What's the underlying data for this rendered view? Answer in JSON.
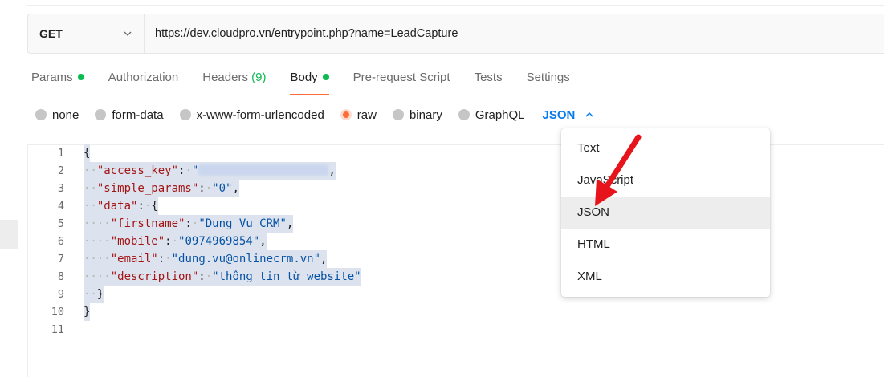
{
  "request": {
    "method": "GET",
    "url": "https://dev.cloudpro.vn/entrypoint.php?name=LeadCapture"
  },
  "tabs": [
    {
      "label": "Params",
      "dot": true
    },
    {
      "label": "Authorization"
    },
    {
      "label": "Headers",
      "count": "(9)"
    },
    {
      "label": "Body",
      "dot": true,
      "active": true
    },
    {
      "label": "Pre-request Script"
    },
    {
      "label": "Tests"
    },
    {
      "label": "Settings"
    }
  ],
  "body_types": {
    "options": [
      "none",
      "form-data",
      "x-www-form-urlencoded",
      "raw",
      "binary",
      "GraphQL"
    ],
    "selected": "raw",
    "language": "JSON"
  },
  "editor": {
    "line_numbers": [
      "1",
      "2",
      "3",
      "4",
      "5",
      "6",
      "7",
      "8",
      "9",
      "10",
      "11"
    ],
    "open_brace": "{",
    "close_brace": "}",
    "access_key": "\"access_key\"",
    "simple_params_key": "\"simple_params\"",
    "simple_params_value": "\"0\"",
    "data_key": "\"data\"",
    "firstname_key": "\"firstname\"",
    "firstname_value": "\"Dung Vu CRM\"",
    "mobile_key": "\"mobile\"",
    "mobile_value": "\"0974969854\"",
    "email_key": "\"email\"",
    "email_value": "\"dung.vu@onlinecrm.vn\"",
    "description_key": "\"description\"",
    "description_value": "\"thông tin từ website\""
  },
  "dropdown": {
    "items": [
      "Text",
      "JavaScript",
      "JSON",
      "HTML",
      "XML"
    ],
    "hovered": "JSON"
  },
  "colors": {
    "accent": "#ff6c37",
    "status_green": "#0cbb52",
    "link_blue": "#097bed",
    "arrow_red": "#e8141b"
  }
}
